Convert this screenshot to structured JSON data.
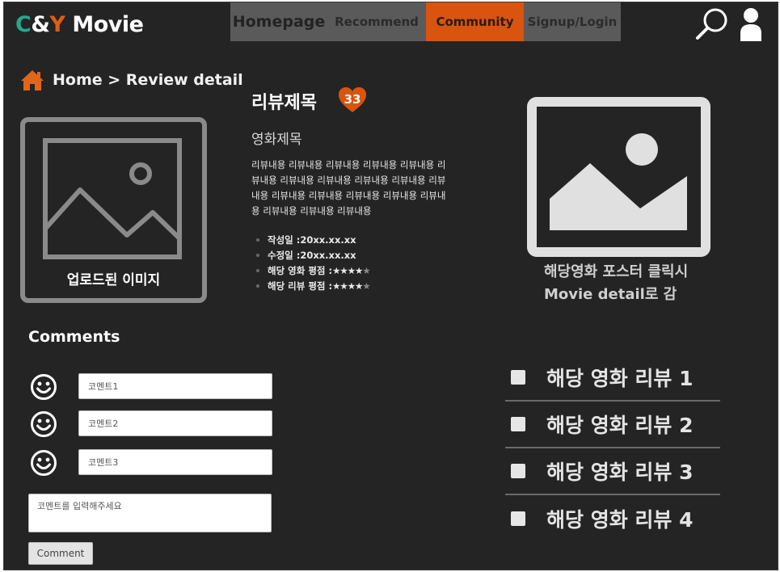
{
  "header": {
    "logo": {
      "c": "C",
      "amp": "&",
      "y": "Y",
      "rest": " Movie"
    },
    "nav": [
      {
        "label": "Homepage",
        "active": false
      },
      {
        "label": "Recommend",
        "active": false
      },
      {
        "label": "Community",
        "active": true
      },
      {
        "label": "Signup/Login",
        "active": false
      }
    ],
    "icons": [
      "search-icon",
      "user-icon"
    ],
    "active_color": "#d9540e"
  },
  "breadcrumb": {
    "text": "Home > Review detail",
    "icon": "home-icon"
  },
  "upload": {
    "label": "업로드된 이미지",
    "icon": "image-placeholder-icon"
  },
  "review": {
    "title": "리뷰제목",
    "likes": "33",
    "movie_title": "영화제목",
    "body": "리뷰내용 리뷰내용 리뷰내용 리뷰내용 리뷰내용 리뷰내용 리뷰내용 리뷰내용 리뷰내용 리뷰내용 리뷰내용 리뷰내용 리뷰내용 리뷰내용 리뷰내용 리뷰내용 리뷰내용 리뷰내용 리뷰내용",
    "meta": [
      {
        "label": "작성일 : ",
        "value": "20xx.xx.xx"
      },
      {
        "label": "수정일 : ",
        "value": "20xx.xx.xx"
      },
      {
        "label": "해당 영화 평점 : ",
        "stars_on": "★★★★",
        "stars_off": "★"
      },
      {
        "label": "해당 리뷰 평점 : ",
        "stars_on": "★★★★",
        "stars_off": "★"
      }
    ]
  },
  "poster": {
    "caption_line1": "해당영화 포스터 클릭시",
    "caption_line2": "Movie detail로 감",
    "icon": "poster-image-icon"
  },
  "comments": {
    "title": "Comments",
    "items": [
      "코멘트1",
      "코멘트2",
      "코멘트3"
    ],
    "input_placeholder": "코멘트를 입력해주세요",
    "button_label": "Comment"
  },
  "related_reviews": [
    "해당 영화 리뷰 1",
    "해당 영화 리뷰 2",
    "해당 영화 리뷰 3",
    "해당 영화 리뷰 4"
  ]
}
